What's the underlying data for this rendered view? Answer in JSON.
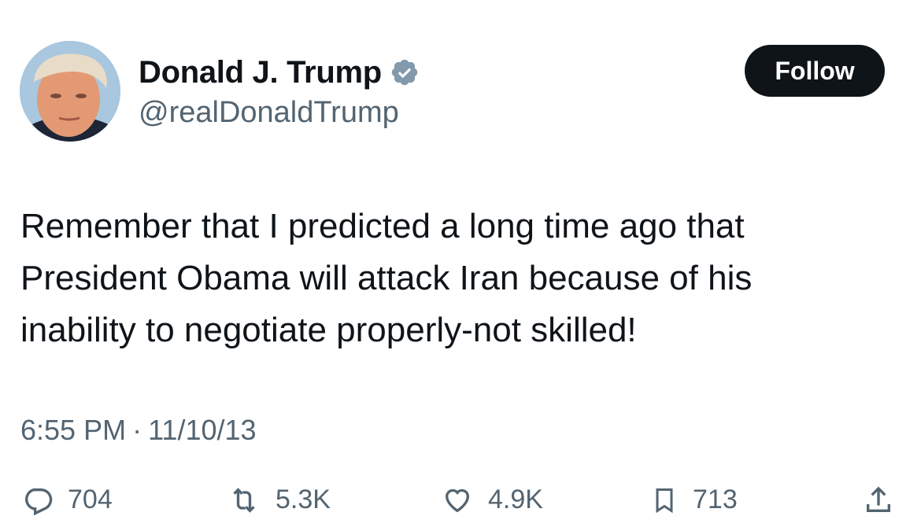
{
  "author": {
    "display_name": "Donald J. Trump",
    "handle": "@realDonaldTrump",
    "verified": true
  },
  "follow_button": {
    "label": "Follow"
  },
  "tweet": {
    "lines": [
      "Remember that I predicted a long time ago that",
      "President Obama will attack Iran because of his",
      "inability to negotiate properly-not skilled!"
    ]
  },
  "meta": {
    "time": "6:55 PM",
    "separator": "·",
    "date": "11/10/13"
  },
  "actions": {
    "reply": {
      "icon": "reply-icon",
      "count": "704"
    },
    "retweet": {
      "icon": "retweet-icon",
      "count": "5.3K"
    },
    "like": {
      "icon": "heart-icon",
      "count": "4.9K"
    },
    "bookmark": {
      "icon": "bookmark-icon",
      "count": "713"
    },
    "share": {
      "icon": "share-icon"
    }
  },
  "colors": {
    "text": "#0f1419",
    "secondary": "#536471",
    "verified": "#829aab",
    "follow_bg": "#0f1419"
  }
}
